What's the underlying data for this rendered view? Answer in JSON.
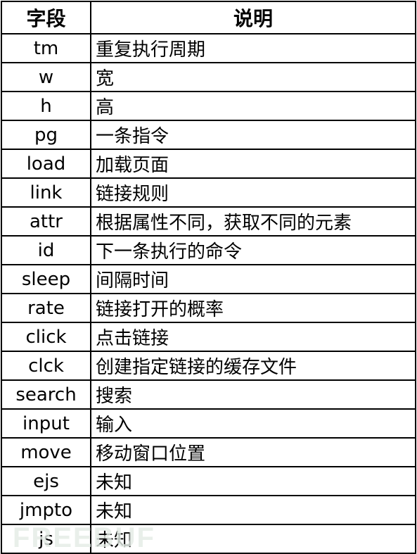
{
  "header": {
    "field": "字段",
    "desc": "说明"
  },
  "rows": [
    {
      "field": "tm",
      "desc": "重复执行周期"
    },
    {
      "field": "w",
      "desc": "宽"
    },
    {
      "field": "h",
      "desc": "高"
    },
    {
      "field": "pg",
      "desc": "一条指令"
    },
    {
      "field": "load",
      "desc": "加载页面"
    },
    {
      "field": "link",
      "desc": "链接规则"
    },
    {
      "field": "attr",
      "desc": "根据属性不同，获取不同的元素"
    },
    {
      "field": "id",
      "desc": "下一条执行的命令"
    },
    {
      "field": "sleep",
      "desc": "间隔时间"
    },
    {
      "field": "rate",
      "desc": "链接打开的概率"
    },
    {
      "field": "click",
      "desc": "点击链接"
    },
    {
      "field": "clck",
      "desc": "创建指定链接的缓存文件"
    },
    {
      "field": "search",
      "desc": "搜索"
    },
    {
      "field": "input",
      "desc": "输入"
    },
    {
      "field": "move",
      "desc": "移动窗口位置"
    },
    {
      "field": "ejs",
      "desc": "未知"
    },
    {
      "field": "jmpto",
      "desc": "未知"
    },
    {
      "field": "js",
      "desc": "未知"
    }
  ],
  "watermark": "FREEBUF"
}
